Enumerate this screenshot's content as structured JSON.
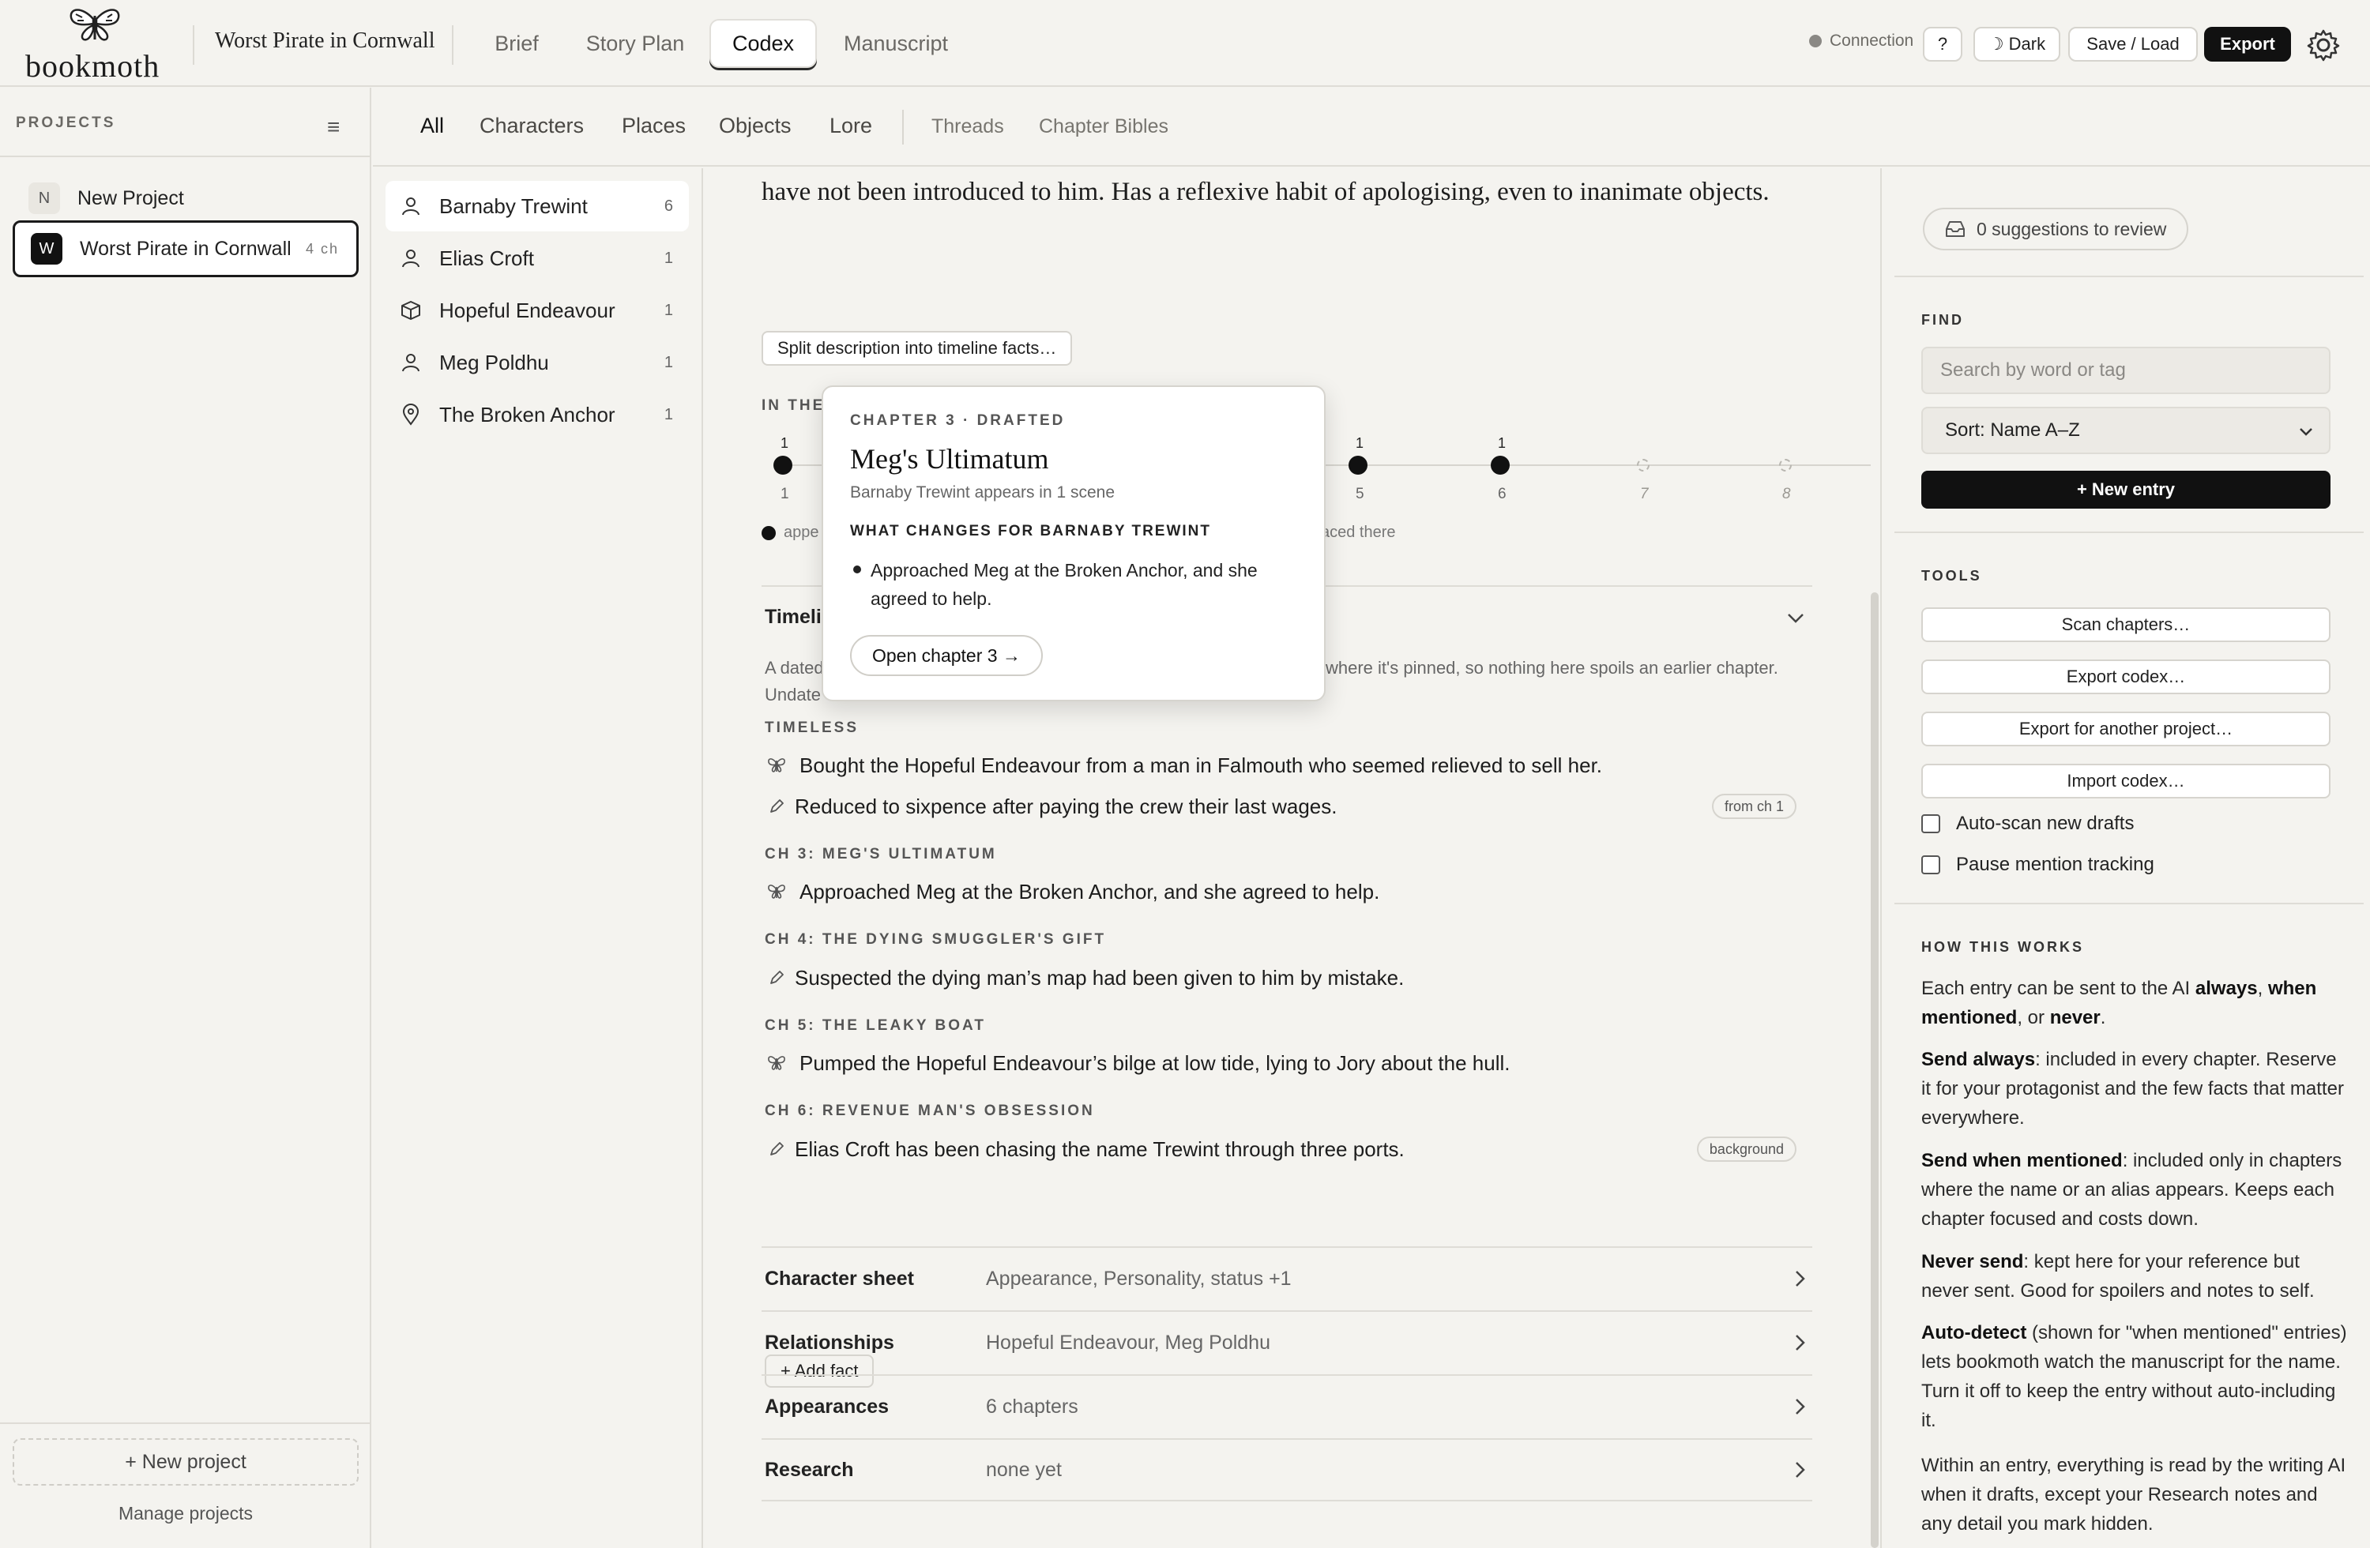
{
  "app": {
    "logo": "bookmoth",
    "project_name": "Worst Pirate in Cornwall"
  },
  "nav": {
    "tabs": [
      "Brief",
      "Story Plan",
      "Codex",
      "Manuscript"
    ],
    "active": "Codex"
  },
  "toolbar": {
    "connection": "Connection",
    "help": "?",
    "dark": "Dark",
    "save_load": "Save / Load",
    "export": "Export"
  },
  "sidebar": {
    "heading": "PROJECTS",
    "projects": [
      {
        "badge": "N",
        "label": "New Project",
        "meta": ""
      },
      {
        "badge": "W",
        "label": "Worst Pirate in Cornwall",
        "meta": "4 ch"
      }
    ],
    "new_project": "+ New project",
    "manage": "Manage projects"
  },
  "codex_tabs": {
    "primary": [
      "All",
      "Characters",
      "Places",
      "Objects",
      "Lore"
    ],
    "secondary": [
      "Threads",
      "Chapter Bibles"
    ]
  },
  "entries": [
    {
      "label": "Barnaby Trewint",
      "count": "6",
      "icon": "person-icon"
    },
    {
      "label": "Elias Croft",
      "count": "1",
      "icon": "person-icon"
    },
    {
      "label": "Hopeful Endeavour",
      "count": "1",
      "icon": "box-icon"
    },
    {
      "label": "Meg Poldhu",
      "count": "1",
      "icon": "person-icon"
    },
    {
      "label": "The Broken Anchor",
      "count": "1",
      "icon": "pin-icon"
    }
  ],
  "main": {
    "description_tail": "have not been introduced to him. Has a reflexive habit of apologising, even to inanimate objects.",
    "split_button": "Split description into timeline facts…",
    "in_the": "IN THE",
    "timeline": {
      "chapters": [
        {
          "num": "1",
          "count": "1",
          "state": "appears"
        },
        {
          "num": "5",
          "count": "1",
          "state": "appears"
        },
        {
          "num": "6",
          "count": "1",
          "state": "appears"
        },
        {
          "num": "7",
          "count": "",
          "state": "empty"
        },
        {
          "num": "8",
          "count": "",
          "state": "empty"
        }
      ],
      "legend_left": "appe",
      "legend_right": "aced there"
    },
    "timeline_title": "Timeli",
    "timeline_intro_a": "A dated",
    "timeline_intro_b": "where it's pinned, so nothing here spoils an earlier chapter.",
    "timeline_intro_c": "Undate",
    "groups": [
      {
        "head": "TIMELESS",
        "facts": [
          {
            "icon": "moth-icon",
            "text": "Bought the Hopeful Endeavour from a man in Falmouth who seemed relieved to sell her.",
            "tag": ""
          },
          {
            "icon": "pencil-icon",
            "text": "Reduced to sixpence after paying the crew their last wages.",
            "tag": "from ch 1"
          }
        ]
      },
      {
        "head": "CH 3: MEG'S ULTIMATUM",
        "facts": [
          {
            "icon": "moth-icon",
            "text": "Approached Meg at the Broken Anchor, and she agreed to help.",
            "tag": ""
          }
        ]
      },
      {
        "head": "CH 4: THE DYING SMUGGLER'S GIFT",
        "facts": [
          {
            "icon": "pencil-icon",
            "text": "Suspected the dying man’s map had been given to him by mistake.",
            "tag": ""
          }
        ]
      },
      {
        "head": "CH 5: THE LEAKY BOAT",
        "facts": [
          {
            "icon": "moth-icon",
            "text": "Pumped the Hopeful Endeavour’s bilge at low tide, lying to Jory about the hull.",
            "tag": ""
          }
        ]
      },
      {
        "head": "CH 6: REVENUE MAN'S OBSESSION",
        "facts": [
          {
            "icon": "pencil-icon",
            "text": "Elias Croft has been chasing the name Trewint through three ports.",
            "tag": "background"
          }
        ]
      }
    ],
    "add_fact": "+ Add fact",
    "sections": [
      {
        "label": "Character sheet",
        "value": "Appearance, Personality, status +1"
      },
      {
        "label": "Relationships",
        "value": "Hopeful Endeavour, Meg Poldhu"
      },
      {
        "label": "Appearances",
        "value": "6 chapters"
      },
      {
        "label": "Research",
        "value": "none yet"
      }
    ]
  },
  "popover": {
    "kicker": "CHAPTER 3 · DRAFTED",
    "title": "Meg's Ultimatum",
    "subtitle": "Barnaby Trewint appears in 1 scene",
    "changes_head": "WHAT CHANGES FOR BARNABY TREWINT",
    "change": "Approached Meg at the Broken Anchor, and she agreed to help.",
    "open_button": "Open chapter 3 →"
  },
  "right": {
    "suggestions": "0 suggestions to review",
    "find_head": "FIND",
    "search_placeholder": "Search by word or tag",
    "sort_value": "Sort: Name A–Z",
    "new_entry": "+ New entry",
    "tools_head": "TOOLS",
    "tools": [
      "Scan chapters…",
      "Export codex…",
      "Export for another project…",
      "Import codex…"
    ],
    "checks": [
      "Auto-scan new drafts",
      "Pause mention tracking"
    ],
    "how_head": "HOW THIS WORKS",
    "how": {
      "p1_a": "Each entry can be sent to the AI ",
      "p1_b": "always",
      "p1_c": ", ",
      "p1_d": "when mentioned",
      "p1_e": ", or ",
      "p1_f": "never",
      "p1_g": ".",
      "p2_b": "Send always",
      "p2_t": ": included in every chapter. Reserve it for your protagonist and the few facts that matter everywhere.",
      "p3_b": "Send when mentioned",
      "p3_t": ": included only in chapters where the name or an alias appears. Keeps each chapter focused and costs down.",
      "p4_b": "Never send",
      "p4_t": ": kept here for your reference but never sent. Good for spoilers and notes to self.",
      "p5_b": "Auto-detect",
      "p5_t": " (shown for \"when mentioned\" entries) lets bookmoth watch the manuscript for the name. Turn it off to keep the entry without auto-including it.",
      "p6": "Within an entry, everything is read by the writing AI when it drafts, except your Research notes and any detail you mark hidden."
    }
  }
}
